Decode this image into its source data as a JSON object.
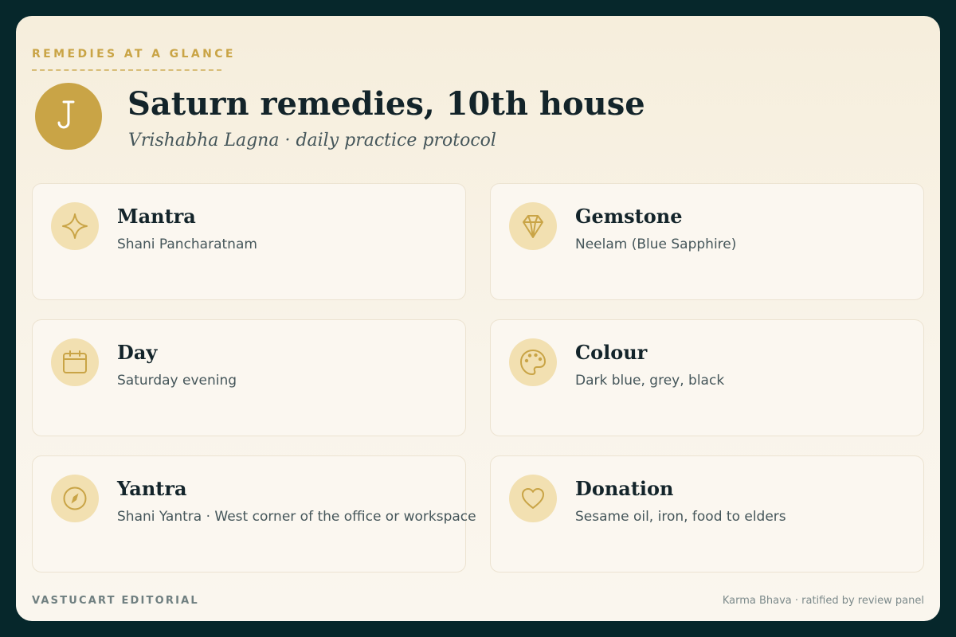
{
  "header": {
    "eyebrow": "REMEDIES AT A GLANCE",
    "badge_icon": "saturn-glyph-icon",
    "title": "Saturn remedies, 10th house",
    "subtitle": "Vrishabha Lagna · daily practice protocol"
  },
  "remedies": [
    {
      "icon": "sparkle-icon",
      "title": "Mantra",
      "text": "Shani Pancharatnam"
    },
    {
      "icon": "gem-icon",
      "title": "Gemstone",
      "text": "Neelam (Blue Sapphire)"
    },
    {
      "icon": "calendar-icon",
      "title": "Day",
      "text": "Saturday evening"
    },
    {
      "icon": "palette-icon",
      "title": "Colour",
      "text": "Dark blue, grey, black"
    },
    {
      "icon": "compass-icon",
      "title": "Yantra",
      "text": "Shani Yantra · West corner of the office or workspace"
    },
    {
      "icon": "heart-icon",
      "title": "Donation",
      "text": "Sesame oil, iron, food to elders"
    }
  ],
  "footer": {
    "brand": "VASTUCART EDITORIAL",
    "note": "Karma Bhava · ratified by review panel"
  },
  "colors": {
    "accent": "#c9a446",
    "icon_bg": "#f2e0b1",
    "frame": "#06272b",
    "ink": "#13242a"
  }
}
